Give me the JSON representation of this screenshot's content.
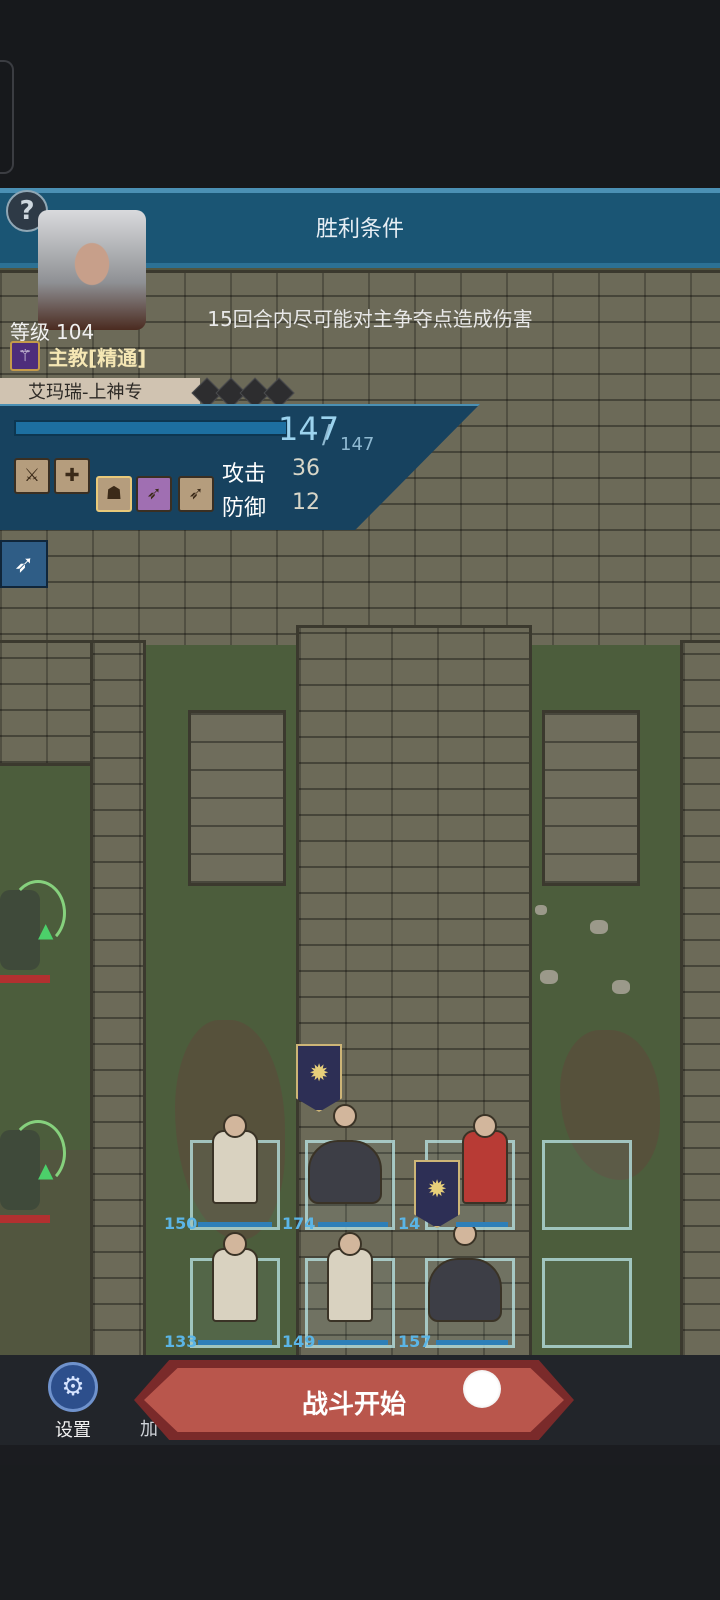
{
  "header": {
    "victory_title": "胜利条件",
    "victory_condition": "15回合内尽可能对主争夺点造成伤害"
  },
  "hero": {
    "level_label": "等级",
    "level": "104",
    "class_name": "主教[精通]",
    "name": "艾玛瑞-上神专",
    "hp": "147",
    "hp_max": "147",
    "attack_label": "攻击",
    "attack": "36",
    "defense_label": "防御",
    "defense": "12"
  },
  "skills": [
    "skill-1-icon",
    "skill-2-icon",
    "skill-3-icon",
    "skill-4-icon",
    "skill-5-icon"
  ],
  "formation": {
    "units": [
      {
        "hp": "150"
      },
      {
        "hp": "174"
      },
      {
        "hp": "14"
      },
      {
        "hp": "133"
      },
      {
        "hp": "149"
      },
      {
        "hp": "157"
      }
    ]
  },
  "bottom": {
    "settings_label": "设置",
    "more_label": "加",
    "start_label": "战斗开始"
  },
  "colors": {
    "banner": "#1a5574",
    "start_button": "#b9564c",
    "hp_text": "#5bb5e6"
  }
}
